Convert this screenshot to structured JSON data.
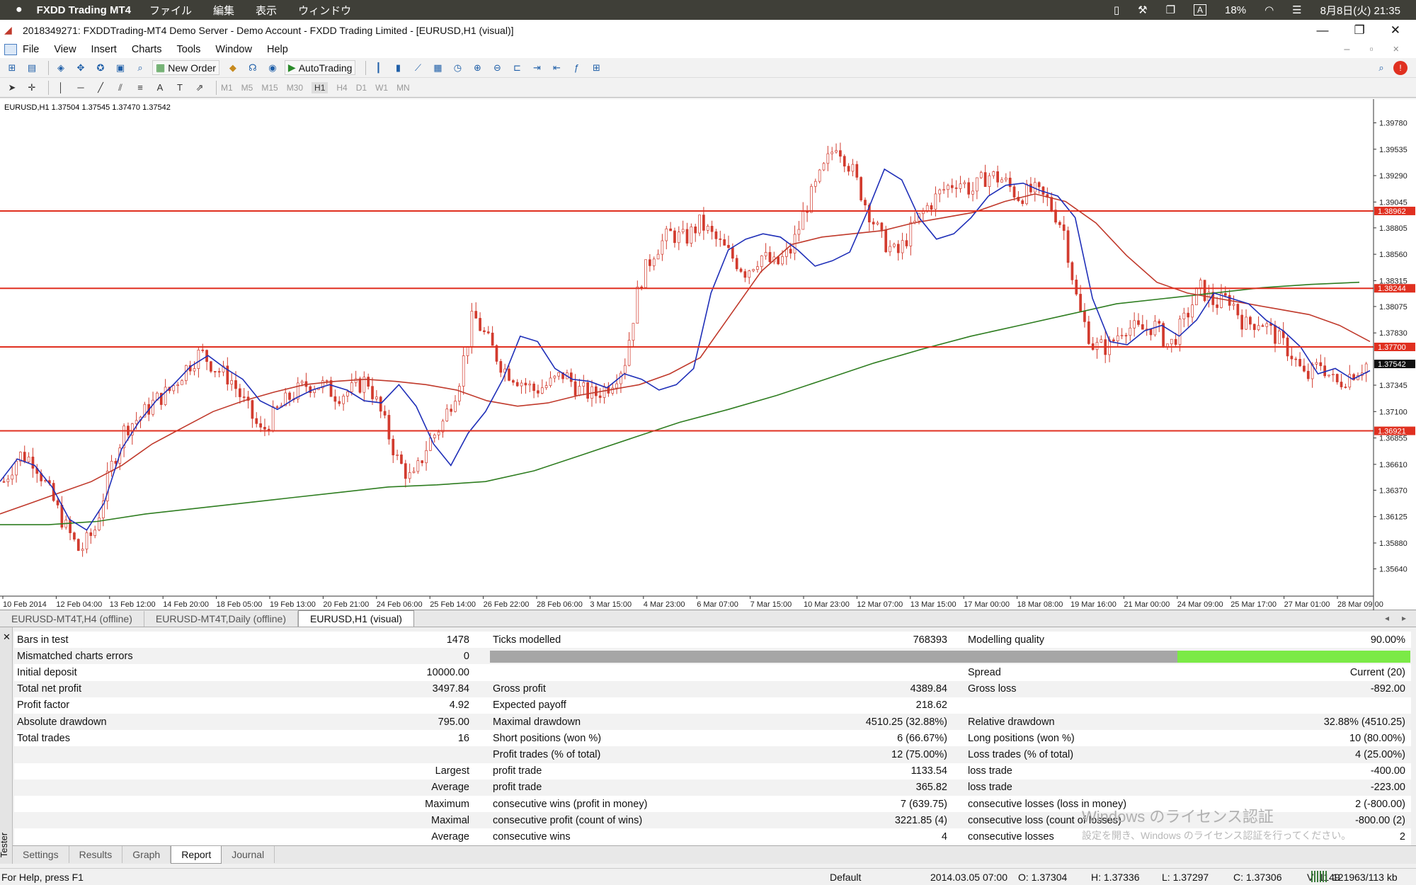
{
  "mac": {
    "app": "FXDD Trading MT4",
    "menus": [
      "ファイル",
      "編集",
      "表示",
      "ウィンドウ"
    ],
    "battery": "18%",
    "datetime": "8月8日(火) 21:35",
    "input_mode": "A"
  },
  "window": {
    "title": "2018349271: FXDDTrading-MT4 Demo Server - Demo Account - FXDD Trading Limited - [EURUSD,H1 (visual)]"
  },
  "menu": [
    "File",
    "View",
    "Insert",
    "Charts",
    "Tools",
    "Window",
    "Help"
  ],
  "toolbar": {
    "new_order": "New Order",
    "autotrading": "AutoTrading",
    "timeframes": [
      "M1",
      "M5",
      "M15",
      "M30",
      "H1",
      "H4",
      "D1",
      "W1",
      "MN"
    ],
    "active_tf": "H1"
  },
  "chart_data": {
    "type": "candlestick",
    "title": "EURUSD,H1  1.37504 1.37545 1.37470 1.37542",
    "ylim": [
      1.354,
      1.4
    ],
    "y_ticks": [
      "1.39780",
      "1.39535",
      "1.39290",
      "1.39045",
      "1.38805",
      "1.38560",
      "1.38315",
      "1.38075",
      "1.37830",
      "1.37345",
      "1.37100",
      "1.36855",
      "1.36610",
      "1.36370",
      "1.36125",
      "1.35880",
      "1.35640"
    ],
    "x_labels": [
      "10 Feb 2014",
      "12 Feb 04:00",
      "13 Feb 12:00",
      "14 Feb 20:00",
      "18 Feb 05:00",
      "19 Feb 13:00",
      "20 Feb 21:00",
      "24 Feb 06:00",
      "25 Feb 14:00",
      "26 Feb 22:00",
      "28 Feb 06:00",
      "3 Mar 15:00",
      "4 Mar 23:00",
      "6 Mar 07:00",
      "7 Mar 15:00",
      "10 Mar 23:00",
      "12 Mar 07:00",
      "13 Mar 15:00",
      "17 Mar 00:00",
      "18 Mar 08:00",
      "19 Mar 16:00",
      "21 Mar 00:00",
      "24 Mar 09:00",
      "25 Mar 17:00",
      "27 Mar 01:00",
      "28 Mar 09:00"
    ],
    "levels": [
      {
        "price": 1.38962,
        "label": "1.38962"
      },
      {
        "price": 1.38244,
        "label": "1.38244"
      },
      {
        "price": 1.377,
        "label": "1.37700"
      },
      {
        "price": 1.36921,
        "label": "1.36921"
      }
    ],
    "current_price": "1.37542",
    "price_path": [
      1.3645,
      1.367,
      1.3665,
      1.3635,
      1.3605,
      1.358,
      1.36,
      1.3655,
      1.3695,
      1.3705,
      1.372,
      1.373,
      1.375,
      1.3765,
      1.375,
      1.374,
      1.3715,
      1.369,
      1.371,
      1.3725,
      1.3735,
      1.3735,
      1.3725,
      1.373,
      1.374,
      1.3705,
      1.3665,
      1.3645,
      1.368,
      1.37,
      1.3735,
      1.38,
      1.3775,
      1.375,
      1.374,
      1.373,
      1.3735,
      1.3745,
      1.373,
      1.3725,
      1.3735,
      1.3755,
      1.383,
      1.386,
      1.3875,
      1.387,
      1.3885,
      1.387,
      1.3855,
      1.384,
      1.3855,
      1.3845,
      1.386,
      1.39,
      1.393,
      1.396,
      1.3935,
      1.39,
      1.387,
      1.3855,
      1.388,
      1.39,
      1.3915,
      1.3925,
      1.3915,
      1.393,
      1.3925,
      1.391,
      1.3915,
      1.3905,
      1.388,
      1.3805,
      1.377,
      1.377,
      1.379,
      1.3785,
      1.379,
      1.377,
      1.3795,
      1.3825,
      1.381,
      1.3815,
      1.379,
      1.3795,
      1.378,
      1.3765,
      1.374,
      1.3755,
      1.3735,
      1.3745,
      1.3754
    ],
    "ma_fast": [
      1.3645,
      1.3666,
      1.366,
      1.364,
      1.361,
      1.36,
      1.3625,
      1.3675,
      1.37,
      1.372,
      1.3735,
      1.3752,
      1.3762,
      1.375,
      1.374,
      1.372,
      1.3712,
      1.3722,
      1.373,
      1.3735,
      1.373,
      1.372,
      1.3718,
      1.3735,
      1.3715,
      1.368,
      1.366,
      1.369,
      1.371,
      1.374,
      1.378,
      1.3775,
      1.375,
      1.374,
      1.3738,
      1.3732,
      1.3745,
      1.374,
      1.373,
      1.3735,
      1.375,
      1.382,
      1.386,
      1.387,
      1.3875,
      1.3872,
      1.386,
      1.3845,
      1.385,
      1.3858,
      1.3895,
      1.3935,
      1.3925,
      1.389,
      1.387,
      1.3875,
      1.389,
      1.391,
      1.392,
      1.3922,
      1.3915,
      1.391,
      1.389,
      1.3815,
      1.3775,
      1.3772,
      1.3785,
      1.379,
      1.378,
      1.3795,
      1.382,
      1.3815,
      1.381,
      1.3795,
      1.3785,
      1.377,
      1.3745,
      1.375,
      1.374,
      1.3748
    ],
    "ma_mid": [
      1.3615,
      1.3625,
      1.3635,
      1.3645,
      1.366,
      1.368,
      1.3695,
      1.371,
      1.372,
      1.3728,
      1.3735,
      1.3738,
      1.374,
      1.3738,
      1.3735,
      1.373,
      1.372,
      1.3715,
      1.3718,
      1.3725,
      1.373,
      1.3735,
      1.3745,
      1.376,
      1.38,
      1.384,
      1.3865,
      1.3872,
      1.3875,
      1.3878,
      1.3885,
      1.389,
      1.3895,
      1.3905,
      1.3912,
      1.3905,
      1.3885,
      1.3855,
      1.383,
      1.382,
      1.3815,
      1.381,
      1.3805,
      1.38,
      1.379,
      1.3775
    ],
    "ma_slow": [
      1.3605,
      1.3605,
      1.3608,
      1.3615,
      1.362,
      1.3625,
      1.363,
      1.3635,
      1.364,
      1.3642,
      1.3645,
      1.3655,
      1.367,
      1.3685,
      1.37,
      1.3712,
      1.3725,
      1.374,
      1.3755,
      1.3768,
      1.378,
      1.379,
      1.38,
      1.381,
      1.3815,
      1.382,
      1.3825,
      1.3828,
      1.383
    ]
  },
  "chart_tabs": [
    "EURUSD-MT4T,H4 (offline)",
    "EURUSD-MT4T,Daily (offline)",
    "EURUSD,H1 (visual)"
  ],
  "report": {
    "rows": [
      {
        "l1": "Bars in test",
        "v1": "1478",
        "l2": "Ticks modelled",
        "v2": "768393",
        "l3": "Modelling quality",
        "v3": "90.00%"
      },
      {
        "l1": "Mismatched charts errors",
        "v1": "0",
        "l2": "",
        "v2": "",
        "l3": "",
        "v3": ""
      },
      {
        "l1": "Initial deposit",
        "v1": "10000.00",
        "l2": "",
        "v2": "",
        "l3": "Spread",
        "v3": "Current (20)"
      },
      {
        "l1": "Total net profit",
        "v1": "3497.84",
        "l2": "Gross profit",
        "v2": "4389.84",
        "l3": "Gross loss",
        "v3": "-892.00"
      },
      {
        "l1": "Profit factor",
        "v1": "4.92",
        "l2": "Expected payoff",
        "v2": "218.62",
        "l3": "",
        "v3": ""
      },
      {
        "l1": "Absolute drawdown",
        "v1": "795.00",
        "l2": "Maximal drawdown",
        "v2": "4510.25 (32.88%)",
        "l3": "Relative drawdown",
        "v3": "32.88% (4510.25)"
      },
      {
        "l1": "Total trades",
        "v1": "16",
        "l2": "Short positions (won %)",
        "v2": "6 (66.67%)",
        "l3": "Long positions (won %)",
        "v3": "10 (80.00%)"
      },
      {
        "l1": "",
        "v1": "",
        "l2": "Profit trades (% of total)",
        "v2": "12 (75.00%)",
        "l3": "Loss trades (% of total)",
        "v3": "4 (25.00%)"
      },
      {
        "l1": "",
        "v1": "Largest",
        "l2": "profit trade",
        "v2": "1133.54",
        "l3": "loss trade",
        "v3": "-400.00"
      },
      {
        "l1": "",
        "v1": "Average",
        "l2": "profit trade",
        "v2": "365.82",
        "l3": "loss trade",
        "v3": "-223.00"
      },
      {
        "l1": "",
        "v1": "Maximum",
        "l2": "consecutive wins (profit in money)",
        "v2": "7 (639.75)",
        "l3": "consecutive losses (loss in money)",
        "v3": "2 (-800.00)"
      },
      {
        "l1": "",
        "v1": "Maximal",
        "l2": "consecutive profit (count of wins)",
        "v2": "3221.85 (4)",
        "l3": "consecutive loss (count of losses)",
        "v3": "-800.00 (2)"
      },
      {
        "l1": "",
        "v1": "Average",
        "l2": "consecutive wins",
        "v2": "4",
        "l3": "consecutive losses",
        "v3": "2"
      }
    ],
    "modelling_quality_fraction": 0.9
  },
  "bottom_tabs": [
    "Settings",
    "Results",
    "Graph",
    "Report",
    "Journal"
  ],
  "active_bottom_tab": "Report",
  "sidebar_label": "Tester",
  "watermark": {
    "line1": "Windows のライセンス認証",
    "line2": "設定を開き、Windows のライセンス認証を行ってください。"
  },
  "status": {
    "help": "For Help, press F1",
    "profile": "Default",
    "time": "2014.03.05 07:00",
    "open": "O: 1.37304",
    "high": "H: 1.37336",
    "low": "L: 1.37297",
    "close": "C: 1.37306",
    "volume": "V: 1149",
    "traffic": "121963/113 kb"
  },
  "colors": {
    "level": "#e03020",
    "ma_fast": "#1f2fb8",
    "ma_mid": "#c0392b",
    "ma_slow": "#2e7d20",
    "quality": "#7bea46"
  }
}
